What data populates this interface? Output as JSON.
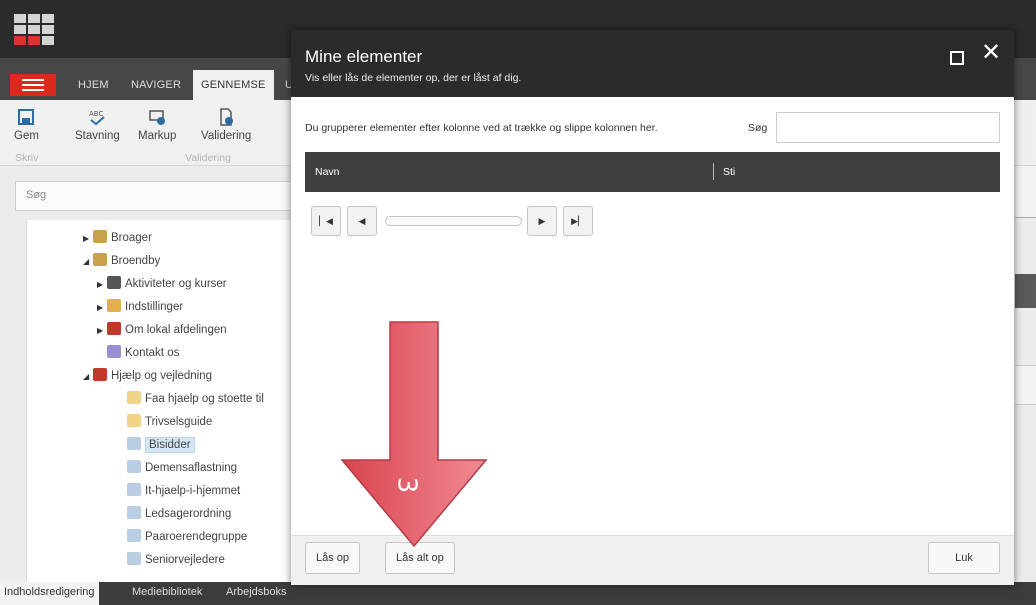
{
  "app": {
    "tabs": [
      "HJEM",
      "NAVIGER",
      "GENNEMSE",
      "U"
    ],
    "active_tab": "GENNEMSE",
    "ribbon": {
      "save": "Gem",
      "spelling": "Stavning",
      "markup": "Markup",
      "validation": "Validering",
      "group_write": "Skriv",
      "group_validation": "Validering"
    },
    "search_placeholder": "Søg",
    "tree": [
      {
        "label": "Broager",
        "arrow": "▶",
        "icon": "home-icon"
      },
      {
        "label": "Broendby",
        "arrow": "◢",
        "icon": "home-icon"
      },
      {
        "label": "Aktiviteter og kurser",
        "arrow": "▶",
        "icon": "soccer-icon"
      },
      {
        "label": "Indstillinger",
        "arrow": "▶",
        "icon": "settings-folder-icon"
      },
      {
        "label": "Om lokal afdelingen",
        "arrow": "▶",
        "icon": "book-icon"
      },
      {
        "label": "Kontakt os",
        "arrow": "",
        "icon": "chat-icon"
      },
      {
        "label": "Hjælp og vejledning",
        "arrow": "◢",
        "icon": "book-icon"
      },
      {
        "label": "Faa hjaelp og stoette til",
        "arrow": "",
        "icon": "folder-icon"
      },
      {
        "label": "Trivselsguide",
        "arrow": "",
        "icon": "folder-icon"
      },
      {
        "label": "Bisidder",
        "arrow": "",
        "icon": "page-icon"
      },
      {
        "label": "Demensaflastning",
        "arrow": "",
        "icon": "page-icon"
      },
      {
        "label": "It-hjaelp-i-hjemmet",
        "arrow": "",
        "icon": "page-icon"
      },
      {
        "label": "Ledsagerordning",
        "arrow": "",
        "icon": "page-icon"
      },
      {
        "label": "Paaroerendegruppe",
        "arrow": "",
        "icon": "page-icon"
      },
      {
        "label": "Seniorvejledere",
        "arrow": "",
        "icon": "page-icon"
      }
    ],
    "bottom_tabs": [
      "Indholdsredigering",
      "Mediebibliotek",
      "Arbejdsboks"
    ]
  },
  "dialog": {
    "title": "Mine elementer",
    "subtitle": "Vis eller lås de elementer op, der er låst af dig.",
    "group_hint": "Du grupperer elementer efter kolonne ved at trække og slippe kolonnen her.",
    "search_label": "Søg",
    "search_value": "",
    "columns": [
      "Navn",
      "Sti"
    ],
    "pager": {
      "first": "▏◀",
      "prev": "◀",
      "next": "▶",
      "last": "▶▏"
    },
    "buttons": {
      "unlock": "Lås op",
      "unlock_all": "Lås alt op",
      "close": "Luk"
    }
  },
  "annotation": {
    "number": "3",
    "color": "#e05560"
  },
  "colors": {
    "accent_red": "#dc291e",
    "dark": "#2b2b2b",
    "selection": "#d5e7f5"
  }
}
